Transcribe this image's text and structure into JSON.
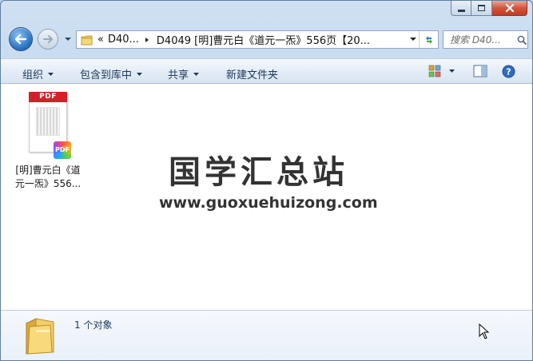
{
  "window": {
    "caption_buttons": [
      "minimize-icon",
      "maximize-icon",
      "close-icon"
    ]
  },
  "address": {
    "crumb1": "D40...",
    "crumb2": "D4049 [明]曹元白《道元一炁》556页【20...",
    "back_icon": "arrow-left-icon",
    "forward_icon": "arrow-right-icon"
  },
  "search": {
    "placeholder": "搜索 D40..."
  },
  "toolbar": {
    "organize": "组织",
    "include_in_library": "包含到库中",
    "share": "共享",
    "new_folder": "新建文件夹"
  },
  "files": [
    {
      "name": "[明]曹元白《道元一炁》556...",
      "icon": "pdf-file-icon",
      "type_label": "PDF"
    }
  ],
  "watermark": {
    "title": "国学汇总站",
    "url": "www.guoxuehuizong.com"
  },
  "details": {
    "count_text": "1 个对象"
  },
  "colors": {
    "pdf_red": "#d3212a",
    "toolbar_text": "#1e395b",
    "close_red": "#c23a22"
  }
}
